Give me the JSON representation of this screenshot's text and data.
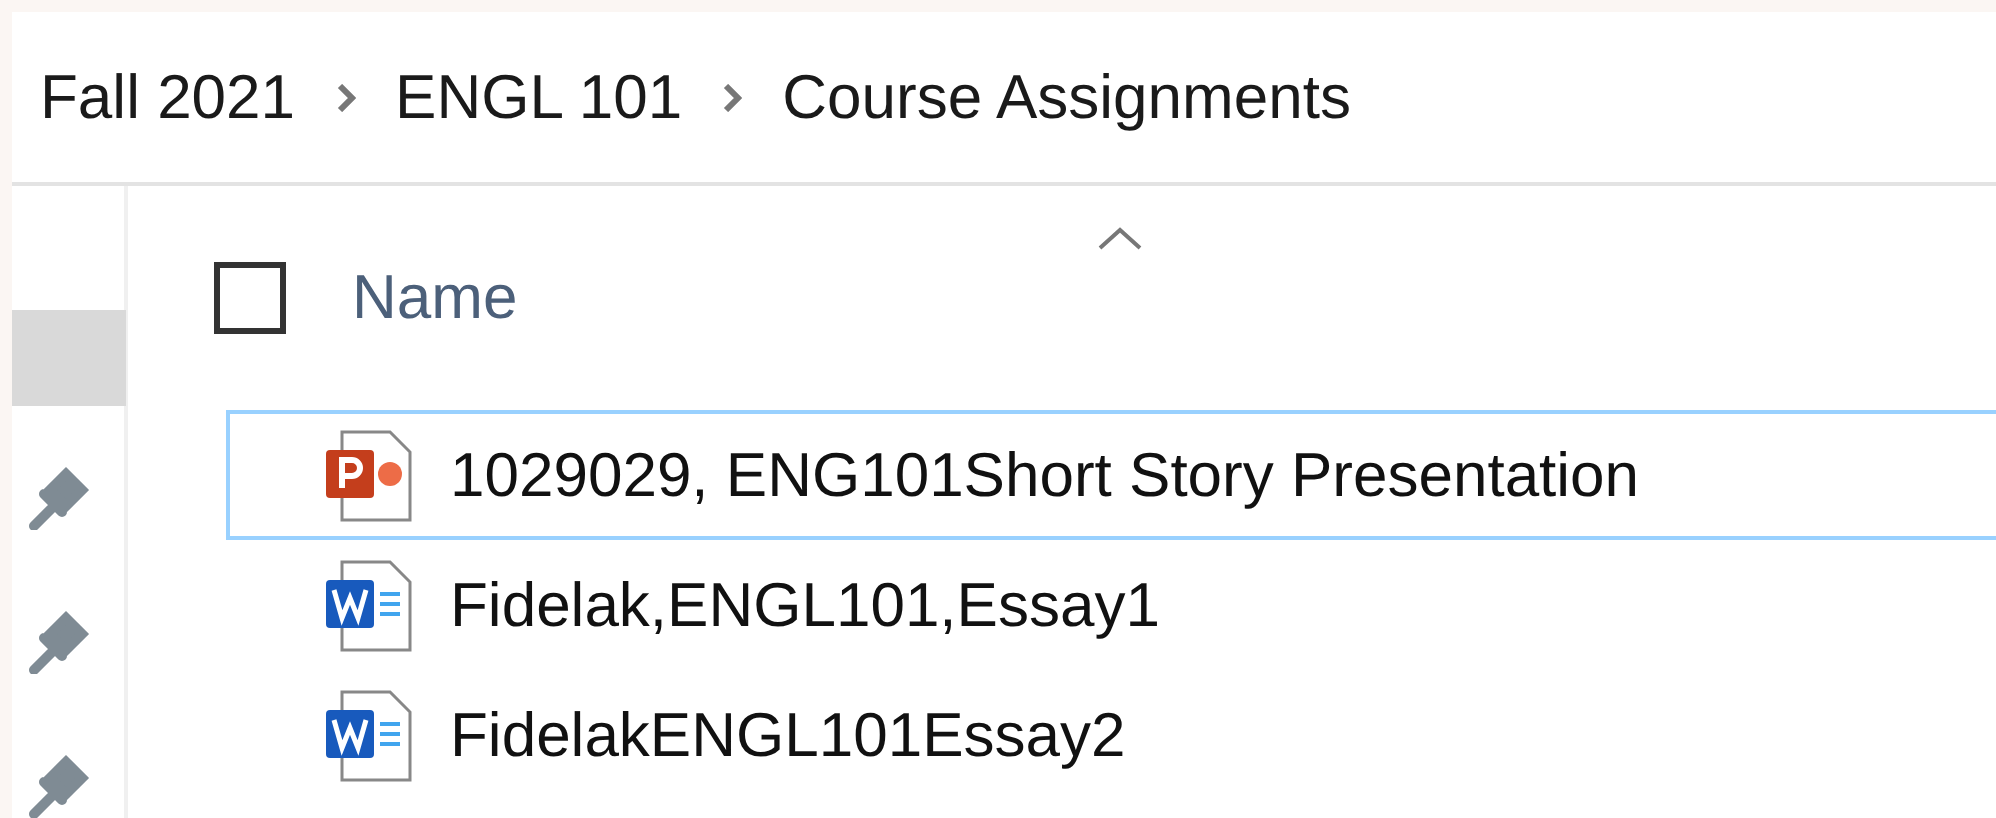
{
  "breadcrumb": [
    "Fall 2021",
    "ENGL 101",
    "Course Assignments"
  ],
  "header": {
    "checkbox_checked": false,
    "name_column": "Name"
  },
  "files": [
    {
      "name": "1029029, ENG101Short Story Presentation",
      "kind": "presentation",
      "focused": true
    },
    {
      "name": "Fidelak,ENGL101,Essay1",
      "kind": "document",
      "focused": false
    },
    {
      "name": "FidelakENGL101Essay2",
      "kind": "document",
      "focused": false
    }
  ]
}
